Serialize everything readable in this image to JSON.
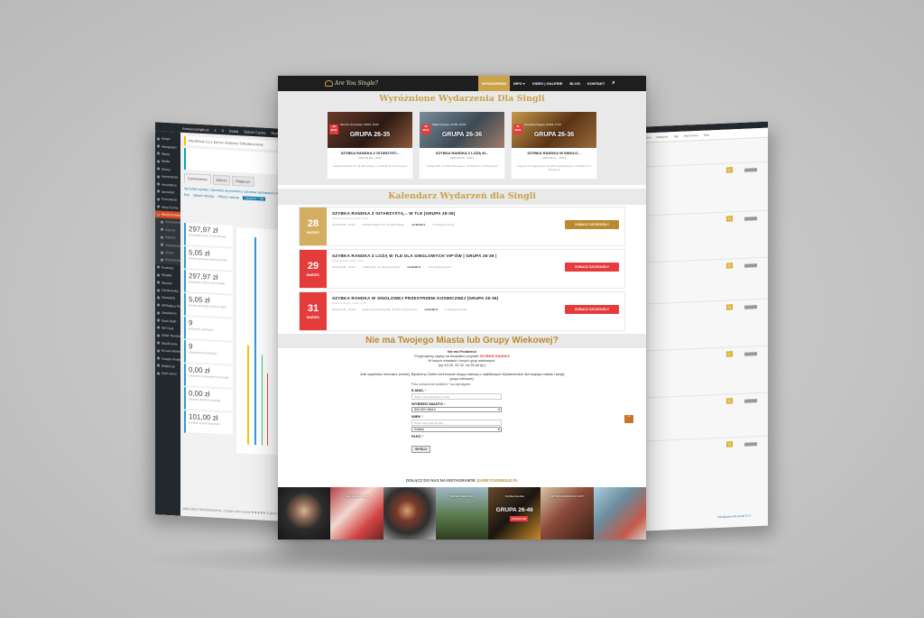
{
  "left_screen": {
    "wp_bar": [
      "Ameyousingle.pl",
      "2",
      "0",
      "Dodaj",
      "Delete Cache",
      "Rank Math SEO"
    ],
    "menu": [
      {
        "label": "Kokpit",
        "state": ""
      },
      {
        "label": "Newspaper",
        "state": ""
      },
      {
        "label": "Wpisy",
        "state": ""
      },
      {
        "label": "Media",
        "state": ""
      },
      {
        "label": "Strony",
        "state": ""
      },
      {
        "label": "Komentarze",
        "state": ""
      },
      {
        "label": "Accordions",
        "state": ""
      },
      {
        "label": "Sprzedaż",
        "state": ""
      },
      {
        "label": "Formularze",
        "state": ""
      },
      {
        "label": "Ninja Forms",
        "state": ""
      },
      {
        "label": "WooCommerce",
        "state": "active"
      },
      {
        "label": "Zamówienia",
        "state": "sub"
      },
      {
        "label": "Kupony",
        "state": "sub"
      },
      {
        "label": "Raporty",
        "state": "sub"
      },
      {
        "label": "Ustawienia",
        "state": "sub"
      },
      {
        "label": "Status",
        "state": "sub"
      },
      {
        "label": "Rozszerzenia",
        "state": "sub"
      },
      {
        "label": "Produkty",
        "state": ""
      },
      {
        "label": "Wygląd",
        "state": ""
      },
      {
        "label": "Wtyczki",
        "state": ""
      },
      {
        "label": "Użytkownicy",
        "state": ""
      },
      {
        "label": "Narzędzia",
        "state": ""
      },
      {
        "label": "WPBakery Page Builder",
        "state": ""
      },
      {
        "label": "Ustawienia",
        "state": ""
      },
      {
        "label": "Rank Math",
        "state": ""
      },
      {
        "label": "WP Dark",
        "state": ""
      },
      {
        "label": "Slider Revolution",
        "state": ""
      },
      {
        "label": "WooEvents",
        "state": ""
      },
      {
        "label": "Envato Market",
        "state": ""
      },
      {
        "label": "Google Analytics",
        "state": ""
      },
      {
        "label": "MailerLite",
        "state": ""
      },
      {
        "label": "Zwiń menu",
        "state": ""
      }
    ],
    "notice_update": "WordPress 5.2.1 jest już dostępny! Zaktualizuj teraz.",
    "tabs": [
      {
        "label": "Zamówienia",
        "state": "on"
      },
      {
        "label": "Klienci",
        "state": ""
      },
      {
        "label": "Magazyn",
        "state": ""
      }
    ],
    "sub_links": "Sprzedaż wg daty | Sprzedaż wg produktu | Sprzedaż wg kategorii | Kupony",
    "range": [
      {
        "label": "Rok",
        "state": ""
      },
      {
        "label": "Ostatni miesiąc",
        "state": ""
      },
      {
        "label": "Obecny miesiąc",
        "state": ""
      },
      {
        "label": "Ostatnie 7 dni",
        "state": "on"
      }
    ],
    "stats": [
      {
        "value": "297,97 zł",
        "label": "sprzedaży brutto w tym okresie"
      },
      {
        "value": "5,05 zł",
        "label": "średnia sprzedaż dzienna brutto"
      },
      {
        "value": "297,97 zł",
        "label": "sprzedaży netto w tym okresie"
      },
      {
        "value": "5,05 zł",
        "label": "średnia sprzedaż dzienna netto"
      },
      {
        "value": "9",
        "label": "złożonych zamówień"
      },
      {
        "value": "9",
        "label": "zakupionych produktów"
      },
      {
        "value": "0,00 zł",
        "label": "zwrócone 0 zamówień (0 pozycji)"
      },
      {
        "value": "0,00 zł",
        "label": "pobrana opłata za wysyłkę"
      },
      {
        "value": "101,00 zł",
        "label": "wartość użytych kuponów"
      }
    ],
    "footer": "Jeśli lubisz WooCommerce, zostaw nam ocenę ★★★★★ Z góry dziękujemy!"
  },
  "right_screen": {
    "headers": [
      "Produkt",
      "Cena",
      "Kategorie",
      "Tagi",
      "Wyróżnione",
      "Data"
    ],
    "footer": "Zarządzanie dla wersji 5.2.1"
  },
  "site": {
    "logo_text": "Are You Single?",
    "nav": [
      {
        "label": "WYDARZENIA",
        "state": "active"
      },
      {
        "label": "INFO ▾",
        "state": ""
      },
      {
        "label": "VIDEO | GALERIE",
        "state": ""
      },
      {
        "label": "BLOG",
        "state": ""
      },
      {
        "label": "KONTAKT",
        "state": ""
      }
    ],
    "search_glyph": "⌕",
    "featured_title": "Wyróżnione Wydarzenia Dla Singli",
    "featured": [
      {
        "date": "28 MAR",
        "top": "Wieczór (Czwartek), GODZ. 18:00",
        "group": "GRUPA 26-35",
        "name": "SZYBKA RANDKA Z GITARZYST...",
        "dt": "2019-03-28 - 18:00",
        "meta": "Gliwicka Walów 20, 44-100 Gliwice  |  od 39,99 zł  |  6 Dostępna",
        "variant": ""
      },
      {
        "date": "29 MAR",
        "top": "Piątek (Singiel), GODZ. 18:00",
        "group": "GRUPA 26-36",
        "name": "SZYBKA RANDKA Z LOŻĄ W...",
        "dt": "2019-03-29 - 18:00",
        "meta": "3 Maja 39A, 41-200 Sosnowiec  |  od 39,99 zł  |  12 Dostępna",
        "variant": "b"
      },
      {
        "date": "31 MAR",
        "top": "Niedziela (Singiel), GODZ. 17:00",
        "group": "GRUPA 26-36",
        "name": "SZYBKA RANDKA W SINGLO...",
        "dt": "2019-03-31 - 18:00",
        "meta": "Aleja Armii Krajowej 66, 42-200 Częstochowa  |  od 39,99 zł  |  6 Dostępna",
        "variant": "c"
      }
    ],
    "calendar_title": "Kalendarz Wydarzeń dla Singli",
    "calendar": [
      {
        "day": "28",
        "month": "MARZEC",
        "color": "gold",
        "title": "SZYBKA RANDKA Z GITARZYSTĄ... W TLE |GRUPA 26-35|",
        "sub": "Wieczór (Czwartek), GODZ. 18:00",
        "date": "2019-03-28 - 18:00",
        "place": "Gliwicka Walów 20, 44-100 Gliwice",
        "price": "od 39,99 zł",
        "left": "6 Dostępna liczba",
        "button": "ZOBACZ SZCZEGÓŁY"
      },
      {
        "day": "29",
        "month": "MARZEC",
        "color": "red",
        "title": "SZYBKA RANDKA Z LOŻĄ W TLE DLA SINGLOWYCH VIP'ÓW | GRUPA 26-36 |",
        "sub": "Piątek (Singiel), GODZ. 18:00",
        "date": "2019-03-29 - 18:00",
        "place": "3 Maja 39A, 41-200 Sosnowiec",
        "price": "od 39,99 zł",
        "left": "12 Dostępna liczba",
        "button": "ZOBACZ SZCZEGÓŁY"
      },
      {
        "day": "31",
        "month": "MARZEC",
        "color": "red",
        "title": "SZYBKA RANDKA W SINGLOWEJ PRZESTRZENI KOSMICZNEJ |GRUPA 26-36|",
        "sub": "Niedziela (Singiel), GODZ. 17:00",
        "date": "2019-03-31 - 18:00",
        "place": "Aleja Armii Krajowej 66, 42-200 Częstochowa",
        "price": "od 39,99 zł",
        "left": "6 Dostępna liczba",
        "button": "ZOBACZ SZCZEGÓŁY"
      }
    ],
    "city_title": "Nie ma Twojego Miasta lub Grupy Wiekowej?",
    "city_text": {
      "l1": "Nie ma Problemu!",
      "l2a": "Przyjmujemy zapisy na bezpłatne przyszłe ",
      "l2b": "SZYBKIE RANDKI",
      "l2c": "!",
      "l3": "W innych miastach i innych grup wiekowych.",
      "l4": "(np.19-25, 22-32, 44-55 lat itp.)",
      "l5": "Jeśli wypełnisz formularz poniżej, Będziemy Ciebie informować drogą mailową o najbliższych Wydarzeniach dla twojego miasta i twojej grupy wiekowej."
    },
    "form": {
      "required_note": "Pola oznaczone znakiem * są wymagane",
      "email_label": "E-MAIL",
      "email_placeholder": "Wpisz tutaj swój adres e-mail",
      "city_label": "WYBIERZ MIASTO",
      "city_value": "BIELSKO-BIAŁA",
      "age_label": "WIEK",
      "age_placeholder": "Wpisz swój wiek (liczba)",
      "sex_value": "Kobieta",
      "sex_label": "PŁEĆ",
      "asterisk": "*",
      "submit": "WYŚLIJ"
    },
    "scroll_top_glyph": "⌃",
    "instagram_prefix": "DOŁĄCZ DO NAS NA INSTAGRAM'IE ",
    "instagram_handle": "@AREYOUSINGLE.PL",
    "gallery": [
      {
        "label": "",
        "small": ""
      },
      {
        "label": "",
        "small": "Twój pierwszy krok"
      },
      {
        "label": "",
        "small": ""
      },
      {
        "label": "",
        "small": "BIZNES MEETING"
      },
      {
        "label": "GRUPA 26-46",
        "small": "Szybka Randka"
      },
      {
        "label": "",
        "small": "SZYBKA RANDKA W LOŻY"
      },
      {
        "label": "",
        "small": ""
      }
    ],
    "gallery_badge": "ZAPISZ SIĘ"
  },
  "colors": {
    "gold": "#c9a24a",
    "red": "#e53b3b",
    "wp_dark": "#23282d",
    "woo_orange": "#d54e21"
  }
}
